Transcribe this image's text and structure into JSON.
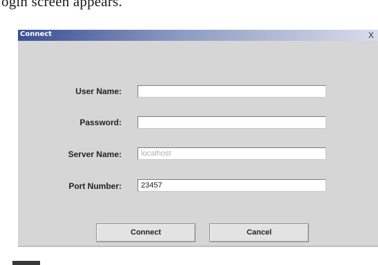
{
  "document": {
    "text_fragment": "ogin screen appears."
  },
  "dialog": {
    "title": "Connect",
    "close_glyph": "X",
    "fields": {
      "user_name": {
        "label": "User Name:",
        "value": ""
      },
      "password": {
        "label": "Password:",
        "value": ""
      },
      "server_name": {
        "label": "Server Name:",
        "value": "",
        "placeholder": "localhost"
      },
      "port_number": {
        "label": "Port Number:",
        "value": "23457"
      }
    },
    "buttons": {
      "connect": "Connect",
      "cancel": "Cancel"
    },
    "colors": {
      "titlebar_start": "#3b4f94",
      "titlebar_end": "#d9dcea",
      "body_background": "#d6d6d6"
    }
  }
}
